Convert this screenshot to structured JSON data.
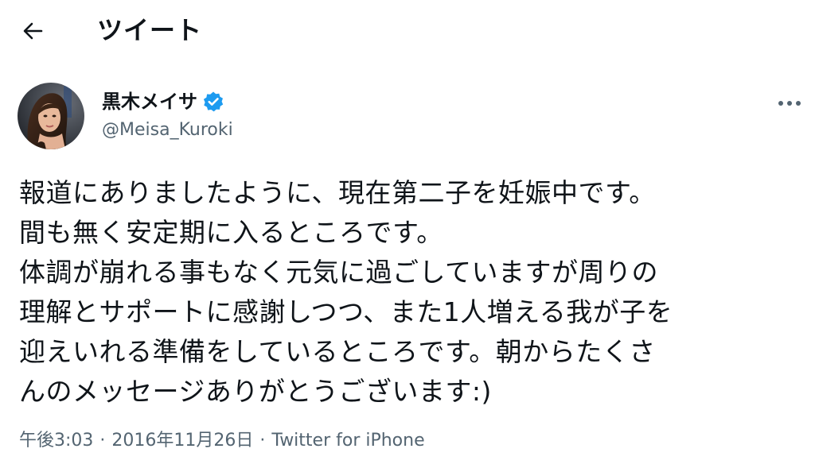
{
  "header": {
    "title": "ツイート",
    "back_icon": "arrow-left-icon"
  },
  "tweet": {
    "author": {
      "name": "黒木メイサ",
      "handle": "@Meisa_Kuroki",
      "verified": true
    },
    "body_lines": [
      "報道にありましたように、現在第二子を妊娠中です。",
      "間も無く安定期に入るところです。",
      "体調が崩れる事もなく元気に過ごしていますが周りの",
      "理解とサポートに感謝しつつ、また1人増える我が子を",
      "迎えいれる準備をしているところです。朝からたくさ",
      "んのメッセージありがとうございます:)"
    ],
    "time": "午後3:03",
    "date": "2016年11月26日",
    "separator": "·",
    "source": "Twitter for iPhone"
  },
  "colors": {
    "text_primary": "#0f1419",
    "text_secondary": "#536471",
    "verified_blue": "#1d9bf0"
  }
}
